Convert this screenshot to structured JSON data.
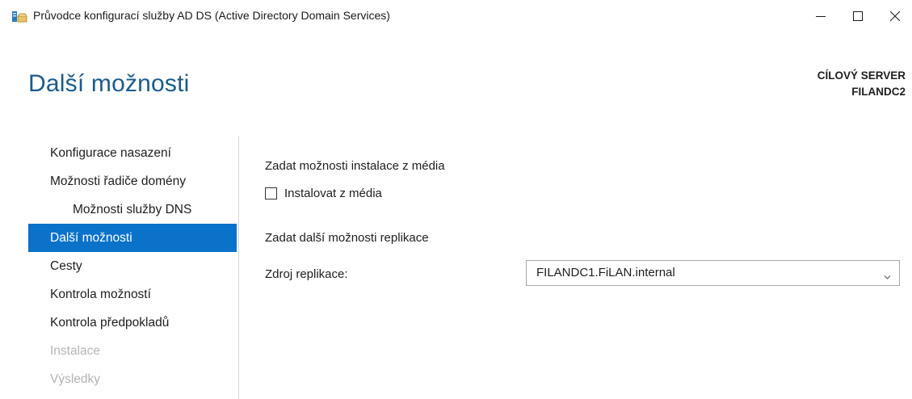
{
  "window": {
    "title": "Průvodce konfigurací služby AD DS (Active Directory Domain Services)",
    "icon": "server-wizard-icon",
    "controls": [
      "minimize-icon",
      "maximize-icon",
      "close-icon"
    ]
  },
  "header": {
    "page_title": "Další možnosti",
    "target_label": "CÍLOVÝ SERVER",
    "target_server": "FILANDC2"
  },
  "nav": {
    "items": [
      {
        "label": "Konfigurace nasazení",
        "state": "normal"
      },
      {
        "label": "Možnosti řadiče domény",
        "state": "normal"
      },
      {
        "label": "Možnosti služby DNS",
        "state": "normal"
      },
      {
        "label": "Další možnosti",
        "state": "active"
      },
      {
        "label": "Cesty",
        "state": "normal"
      },
      {
        "label": "Kontrola možností",
        "state": "normal"
      },
      {
        "label": "Kontrola předpokladů",
        "state": "normal"
      },
      {
        "label": "Instalace",
        "state": "disabled"
      },
      {
        "label": "Výsledky",
        "state": "disabled"
      }
    ]
  },
  "content": {
    "media_section_title": "Zadat možnosti instalace z média",
    "install_from_media_label": "Instalovat z média",
    "install_from_media_checked": false,
    "replication_section_title": "Zadat další možnosti replikace",
    "replication_source_label": "Zdroj replikace:",
    "replication_source_value": "FILANDC1.FiLAN.internal"
  },
  "colors": {
    "accent": "#0b72c9",
    "title": "#1b5b8a",
    "disabled_text": "#b4b4b4"
  }
}
